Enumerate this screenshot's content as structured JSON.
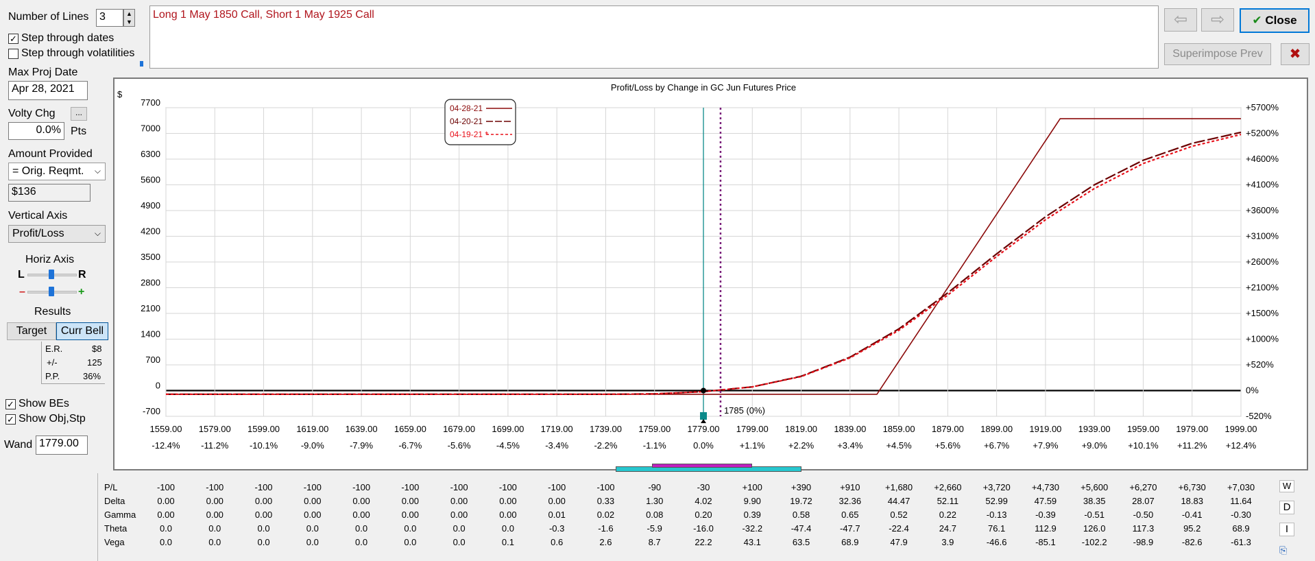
{
  "controls": {
    "num_lines_label": "Number of Lines",
    "num_lines_value": "3",
    "step_dates_label": "Step through dates",
    "step_dates_checked": true,
    "step_vols_label": "Step through volatilities",
    "step_vols_checked": false,
    "max_proj_label": "Max Proj Date",
    "max_proj_value": "Apr 28, 2021",
    "volty_label": "Volty Chg",
    "volty_btn": "...",
    "volty_value": "0.0%",
    "volty_unit": "Pts",
    "amount_label": "Amount Provided",
    "amount_select": "= Orig. Reqmt.",
    "amount_value": "$136",
    "vert_axis_label": "Vertical Axis",
    "vert_axis_select": "Profit/Loss",
    "horiz_axis_label": "Horiz Axis",
    "l_label": "L",
    "r_label": "R",
    "minus_label": "–",
    "plus_label": "+",
    "results_label": "Results",
    "target_btn": "Target",
    "currbell_btn": "Curr Bell",
    "er_label": "E.R.",
    "er_value": "$8",
    "pm_label": "+/-",
    "pm_value": "125",
    "pp_label": "P.P.",
    "pp_value": "36%",
    "show_bes_label": "Show BEs",
    "show_bes_checked": true,
    "show_obj_label": "Show Obj,Stp",
    "show_obj_checked": true,
    "wand_label": "Wand",
    "wand_value": "1779.00"
  },
  "description": "Long 1 May 1850 Call, Short 1 May 1925 Call",
  "buttons": {
    "close": "Close",
    "superimpose": "Superimpose Prev",
    "check_glyph": "✔",
    "x_glyph": "✖",
    "back_glyph": "⇦",
    "fwd_glyph": "⇨"
  },
  "colors": {
    "series1": "#8b0a0a",
    "series2": "#6b0000",
    "series3": "#e8101a",
    "wand": "#0a8a8a",
    "target": "#7a1f7a",
    "bell_cyan": "#27c7cf",
    "bell_magenta": "#c020c0"
  },
  "chart_data": {
    "type": "line",
    "title": "Profit/Loss by Change in GC Jun Futures Price",
    "left_unit": "$",
    "y_ticks": [
      -700,
      0,
      700,
      1400,
      2100,
      2800,
      3500,
      4200,
      4900,
      5600,
      6300,
      7000,
      7700
    ],
    "right_ticks": [
      "-520%",
      "0%",
      "+520%",
      "+1000%",
      "+1500%",
      "+2100%",
      "+2600%",
      "+3100%",
      "+3600%",
      "+4100%",
      "+4600%",
      "+5200%",
      "+5700%"
    ],
    "ylim": [
      -700,
      7700
    ],
    "xlim": [
      1559,
      1999
    ],
    "x_ticks": [
      "1559.00",
      "1579.00",
      "1599.00",
      "1619.00",
      "1639.00",
      "1659.00",
      "1679.00",
      "1699.00",
      "1719.00",
      "1739.00",
      "1759.00",
      "1779.00",
      "1799.00",
      "1819.00",
      "1839.00",
      "1859.00",
      "1879.00",
      "1899.00",
      "1919.00",
      "1939.00",
      "1959.00",
      "1979.00",
      "1999.00"
    ],
    "x_pct": [
      "-12.4%",
      "-11.2%",
      "-10.1%",
      "-9.0%",
      "-7.9%",
      "-6.7%",
      "-5.6%",
      "-4.5%",
      "-3.4%",
      "-2.2%",
      "-1.1%",
      "0.0%",
      "+1.1%",
      "+2.2%",
      "+3.4%",
      "+4.5%",
      "+5.6%",
      "+6.7%",
      "+7.9%",
      "+9.0%",
      "+10.1%",
      "+11.2%",
      "+12.4%"
    ],
    "wand_x": 1779,
    "target_x": 1786,
    "target_label": "1785 (0%)",
    "legend": [
      "04-28-21",
      "04-20-21",
      "04-19-21 *"
    ],
    "series": [
      {
        "name": "04-28-21",
        "x": [
          1559,
          1850,
          1925,
          1999
        ],
        "values": [
          -100,
          -100,
          7400,
          7400
        ]
      },
      {
        "name": "04-20-21",
        "x": [
          1559,
          1739,
          1759,
          1779,
          1799,
          1819,
          1839,
          1859,
          1879,
          1899,
          1919,
          1939,
          1959,
          1979,
          1999
        ],
        "values": [
          -100,
          -100,
          -90,
          -30,
          100,
          390,
          910,
          1680,
          2660,
          3720,
          4730,
          5600,
          6270,
          6730,
          7030
        ]
      },
      {
        "name": "04-19-21 *",
        "x": [
          1559,
          1739,
          1759,
          1779,
          1799,
          1819,
          1839,
          1859,
          1879,
          1899,
          1919,
          1939,
          1959,
          1979,
          1999
        ],
        "values": [
          -100,
          -100,
          -90,
          -30,
          100,
          380,
          890,
          1640,
          2600,
          3650,
          4650,
          5500,
          6180,
          6650,
          6970
        ]
      }
    ]
  },
  "table": {
    "row_labels": [
      "P/L",
      "Delta",
      "Gamma",
      "Theta",
      "Vega"
    ],
    "rows": [
      [
        "-100",
        "-100",
        "-100",
        "-100",
        "-100",
        "-100",
        "-100",
        "-100",
        "-100",
        "-100",
        "-90",
        "-30",
        "+100",
        "+390",
        "+910",
        "+1,680",
        "+2,660",
        "+3,720",
        "+4,730",
        "+5,600",
        "+6,270",
        "+6,730",
        "+7,030"
      ],
      [
        "0.00",
        "0.00",
        "0.00",
        "0.00",
        "0.00",
        "0.00",
        "0.00",
        "0.00",
        "0.00",
        "0.33",
        "1.30",
        "4.02",
        "9.90",
        "19.72",
        "32.36",
        "44.47",
        "52.11",
        "52.99",
        "47.59",
        "38.35",
        "28.07",
        "18.83",
        "11.64"
      ],
      [
        "0.00",
        "0.00",
        "0.00",
        "0.00",
        "0.00",
        "0.00",
        "0.00",
        "0.00",
        "0.01",
        "0.02",
        "0.08",
        "0.20",
        "0.39",
        "0.58",
        "0.65",
        "0.52",
        "0.22",
        "-0.13",
        "-0.39",
        "-0.51",
        "-0.50",
        "-0.41",
        "-0.30"
      ],
      [
        "0.0",
        "0.0",
        "0.0",
        "0.0",
        "0.0",
        "0.0",
        "0.0",
        "0.0",
        "-0.3",
        "-1.6",
        "-5.9",
        "-16.0",
        "-32.2",
        "-47.4",
        "-47.7",
        "-22.4",
        "24.7",
        "76.1",
        "112.9",
        "126.0",
        "117.3",
        "95.2",
        "68.9"
      ],
      [
        "0.0",
        "0.0",
        "0.0",
        "0.0",
        "0.0",
        "0.0",
        "0.0",
        "0.1",
        "0.6",
        "2.6",
        "8.7",
        "22.2",
        "43.1",
        "63.5",
        "68.9",
        "47.9",
        "3.9",
        "-46.6",
        "-85.1",
        "-102.2",
        "-98.9",
        "-82.6",
        "-61.3"
      ]
    ],
    "side_w": "W",
    "side_d": "D",
    "side_i": "I"
  }
}
